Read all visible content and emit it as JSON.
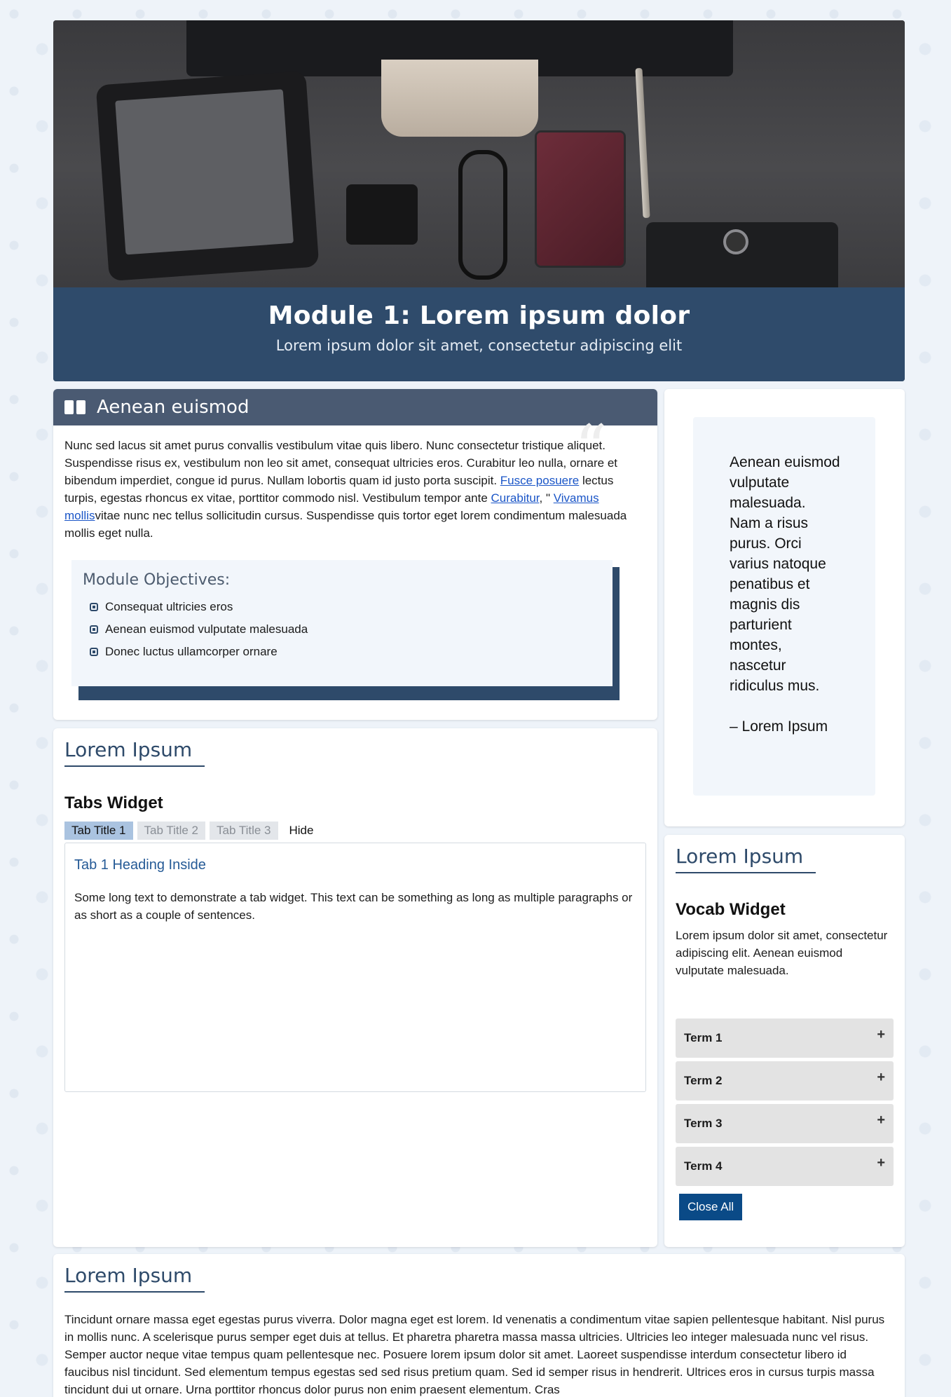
{
  "hero": {
    "title": "Module 1: Lorem ipsum dolor",
    "subtitle": "Lorem ipsum dolor sit amet, consectetur adipiscing elit"
  },
  "intro": {
    "title": "Aenean euismod",
    "body_part1": "Nunc sed lacus sit amet purus convallis vestibulum vitae quis libero. Nunc consectetur tristique aliquet. Suspendisse risus ex, vestibulum non leo sit amet, consequat ultricies eros. Curabitur leo nulla, ornare et bibendum imperdiet, congue id purus. Nullam lobortis quam id justo porta suscipit. ",
    "link1": "Fusce posuere",
    "body_part2": " lectus turpis, egestas rhoncus ex vitae, porttitor commodo nisl. Vestibulum tempor ante ",
    "link2": "Curabitur",
    "body_part3": ", \" ",
    "link3": "Vivamus mollis",
    "body_part4": "vitae nunc nec tellus sollicitudin cursus. Suspendisse quis tortor eget lorem condimentum malesuada mollis eget nulla.",
    "objectives_title": "Module Objectives:",
    "objectives": [
      "Consequat ultricies eros",
      "Aenean euismod vulputate malesuada",
      "Donec luctus ullamcorper ornare"
    ]
  },
  "quote": {
    "text": "Aenean euismod vulputate malesuada. Nam a risus purus. Orci varius natoque penatibus et magnis dis parturient montes, nascetur ridiculus mus.",
    "author": "– Lorem Ipsum"
  },
  "tabs_card": {
    "section_title": "Lorem Ipsum",
    "widget_title": "Tabs Widget",
    "tabs": [
      "Tab Title 1",
      "Tab Title 2",
      "Tab Title 3"
    ],
    "hide_label": "Hide",
    "panel_heading": "Tab 1 Heading Inside",
    "panel_text": "Some long text to demonstrate a tab widget. This text can be something as long as multiple paragraphs or as short as a couple of sentences."
  },
  "vocab_card": {
    "section_title": "Lorem Ipsum",
    "widget_title": "Vocab Widget",
    "text": "Lorem ipsum dolor sit amet, consectetur adipiscing elit. Aenean euismod vulputate malesuada.",
    "terms": [
      "Term 1",
      "Term 2",
      "Term 3",
      "Term 4"
    ],
    "close_all": "Close All"
  },
  "bottom_card": {
    "section_title": "Lorem Ipsum",
    "text": "Tincidunt ornare massa eget egestas purus viverra. Dolor magna eget est lorem. Id venenatis a condimentum vitae sapien pellentesque habitant. Nisl purus in mollis nunc. A scelerisque purus semper eget duis at tellus. Et pharetra pharetra massa massa ultricies. Ultricies leo integer malesuada nunc vel risus. Semper auctor neque vitae tempus quam pellentesque nec. Posuere lorem ipsum dolor sit amet. Laoreet suspendisse interdum consectetur libero id faucibus nisl tincidunt. Sed elementum tempus egestas sed sed risus pretium quam. Sed id semper risus in hendrerit. Ultrices eros in cursus turpis massa tincidunt dui ut ornare. Urna porttitor rhoncus dolor purus non enim praesent elementum. Cras"
  },
  "colors": {
    "header_band": "#2f4b6b",
    "accent": "#2e4a6a",
    "link": "#1a55c7",
    "button": "#0a4a87"
  },
  "icons": {
    "intro": "book-open-icon",
    "objective_bullet": "square-bullet-icon",
    "term_toggle": "plus-icon"
  }
}
